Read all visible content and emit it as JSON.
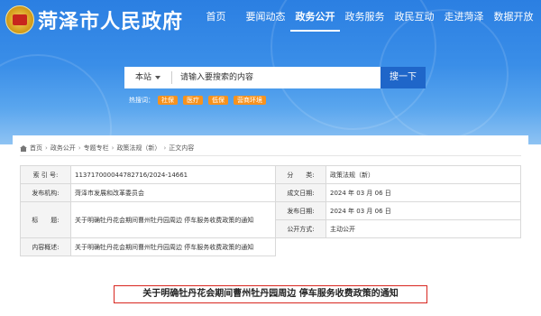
{
  "header": {
    "site_title": "菏泽市人民政府",
    "nav": [
      {
        "label": "首页",
        "active": false
      },
      {
        "label": "要闻动态",
        "active": false
      },
      {
        "label": "政务公开",
        "active": true
      },
      {
        "label": "政务服务",
        "active": false
      },
      {
        "label": "政民互动",
        "active": false
      },
      {
        "label": "走进菏泽",
        "active": false
      },
      {
        "label": "数据开放",
        "active": false
      }
    ]
  },
  "search": {
    "scope": "本站",
    "placeholder": "请输入要搜索的内容",
    "button": "搜一下",
    "hot_label": "热搜词：",
    "hot_words": [
      "社保",
      "医疗",
      "低保",
      "营商环境"
    ]
  },
  "breadcrumb": [
    "首页",
    "政务公开",
    "专题专栏",
    "政策法规（新）",
    "正文内容"
  ],
  "meta": {
    "index_no_label": "索 引 号:",
    "index_no": "11371700004478271​6/2024-14661",
    "category_label": "分　　类:",
    "category": "政策法规（新）",
    "publisher_label": "发布机构:",
    "publisher": "菏泽市发展和改革委员会",
    "created_label": "成文日期:",
    "created": "2024 年 03 月 06 日",
    "published_label": "发布日期:",
    "published": "2024 年 03 月 06 日",
    "title_label": "标　　题:",
    "title": "关于明确牡丹花会期间曹州牡丹园周边 停车服务收费政策的通知",
    "disclosure_label": "公开方式:",
    "disclosure": "主动公开",
    "summary_label": "内容概述:",
    "summary": "关于明确牡丹花会期间曹州牡丹园周边 停车服务收费政策的通知"
  },
  "doc_title": "关于明确牡丹花会期间曹州牡丹园周边 停车服务收费政策的通知",
  "colors": {
    "header_blue": "#2b7fe2",
    "search_button": "#1f66c9",
    "tag_orange": "#f6921e",
    "title_border": "#d8261f"
  }
}
